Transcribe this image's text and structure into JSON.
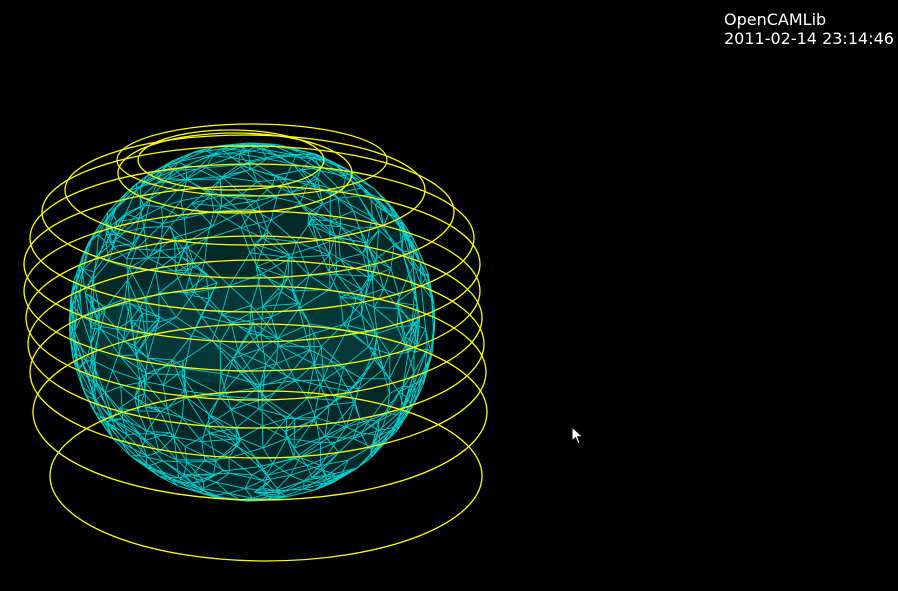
{
  "overlay": {
    "title": "OpenCAMLib",
    "timestamp": "2011-02-14 23:14:46"
  },
  "scene": {
    "background_color": "#000000",
    "mesh_color": "#00e6e6",
    "contour_color": "#ffff00",
    "objects": [
      "sphere-wireframe-mesh",
      "waterline-contours"
    ],
    "waterline_count": 12
  },
  "cursor": {
    "icon": "arrow-pointer-icon"
  }
}
